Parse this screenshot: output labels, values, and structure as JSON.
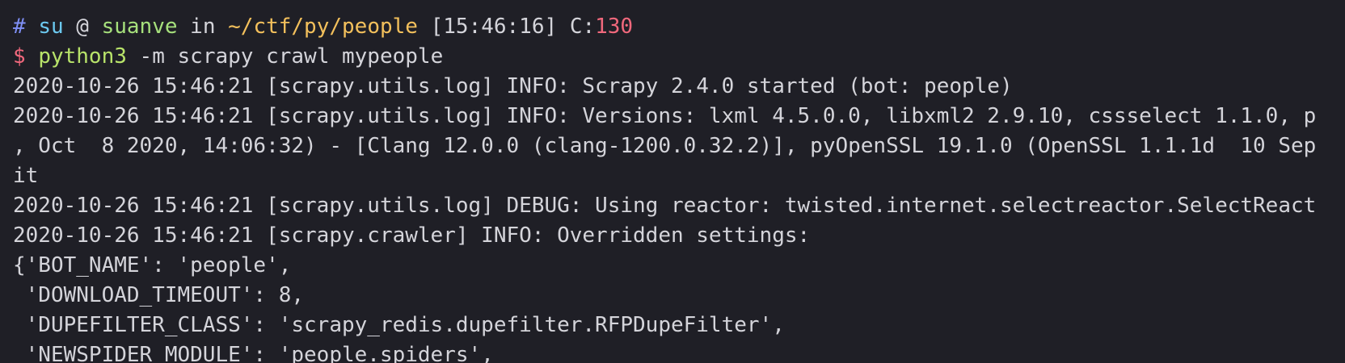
{
  "colors": {
    "background": "#1f1f26",
    "text": "#d4d4da",
    "hash": "#7f8ff5",
    "user": "#6cc9f0",
    "host": "#a6e07c",
    "path": "#f3c05c",
    "exit_code": "#f0687c",
    "prompt_symbol": "#f0687c",
    "command": "#b8e36a"
  },
  "prompt_header": {
    "hash": "#",
    "user": "su",
    "at": "@",
    "host": "suanve",
    "in": "in",
    "path": "~/ctf/py/people",
    "time": "[15:46:16]",
    "exit_label": "C:",
    "exit_code": "130"
  },
  "command_line": {
    "symbol": "$",
    "program": "python3",
    "args": "-m scrapy crawl mypeople"
  },
  "output_lines": [
    "2020-10-26 15:46:21 [scrapy.utils.log] INFO: Scrapy 2.4.0 started (bot: people)",
    "2020-10-26 15:46:21 [scrapy.utils.log] INFO: Versions: lxml 4.5.0.0, libxml2 2.9.10, cssselect 1.1.0, p",
    ", Oct  8 2020, 14:06:32) - [Clang 12.0.0 (clang-1200.0.32.2)], pyOpenSSL 19.1.0 (OpenSSL 1.1.1d  10 Sep",
    "it",
    "2020-10-26 15:46:21 [scrapy.utils.log] DEBUG: Using reactor: twisted.internet.selectreactor.SelectReact",
    "2020-10-26 15:46:21 [scrapy.crawler] INFO: Overridden settings:",
    "{'BOT_NAME': 'people',",
    " 'DOWNLOAD_TIMEOUT': 8,",
    " 'DUPEFILTER_CLASS': 'scrapy_redis.dupefilter.RFPDupeFilter',",
    " 'NEWSPIDER_MODULE': 'people.spiders',"
  ]
}
